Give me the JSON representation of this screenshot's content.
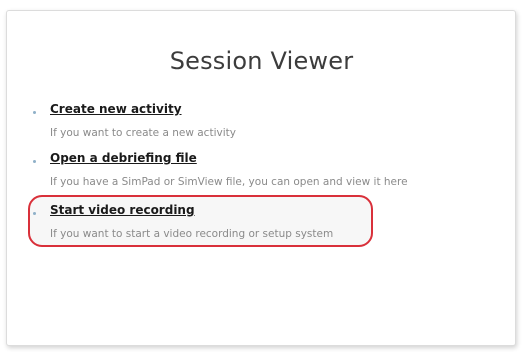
{
  "title": "Session Viewer",
  "items": [
    {
      "label": "Create new activity",
      "description": "If you want to create a new activity"
    },
    {
      "label": "Open a debriefing file",
      "description": "If you have a SimPad or SimView file, you can open and view it here"
    },
    {
      "label": "Start video recording",
      "description": "If you want to start a video recording or setup system"
    }
  ],
  "highlight_color": "#d9303a"
}
